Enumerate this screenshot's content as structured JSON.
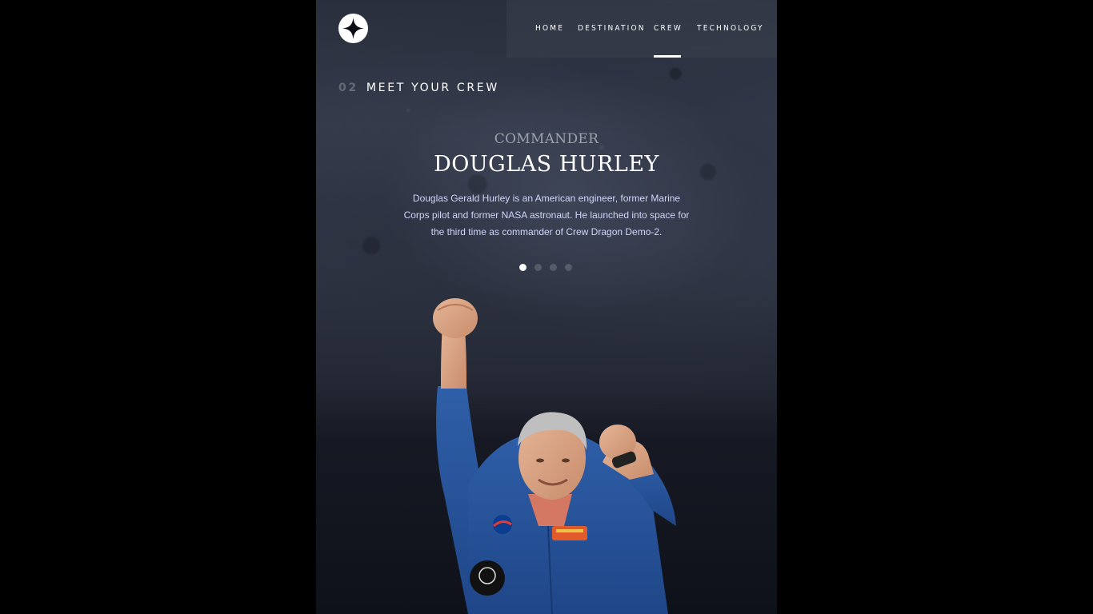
{
  "nav": {
    "items": [
      {
        "label": "HOME",
        "active": false
      },
      {
        "label": "DESTINATION",
        "active": false
      },
      {
        "label": "CREW",
        "active": true
      },
      {
        "label": "TECHNOLOGY",
        "active": false
      }
    ]
  },
  "header": {
    "logo_icon": "star-logo-icon"
  },
  "page": {
    "number": "02",
    "title": "MEET YOUR CREW"
  },
  "crew": {
    "role": "COMMANDER",
    "name": "DOUGLAS HURLEY",
    "bio": "Douglas Gerald Hurley is an American engineer, former Marine Corps pilot and former NASA astronaut. He launched into space for the third time as commander of Crew Dragon Demo-2.",
    "selected_index": 0,
    "member_count": 4
  },
  "colors": {
    "background": "#0b0d17",
    "accent_text": "#d0d6f9",
    "white": "#ffffff"
  }
}
